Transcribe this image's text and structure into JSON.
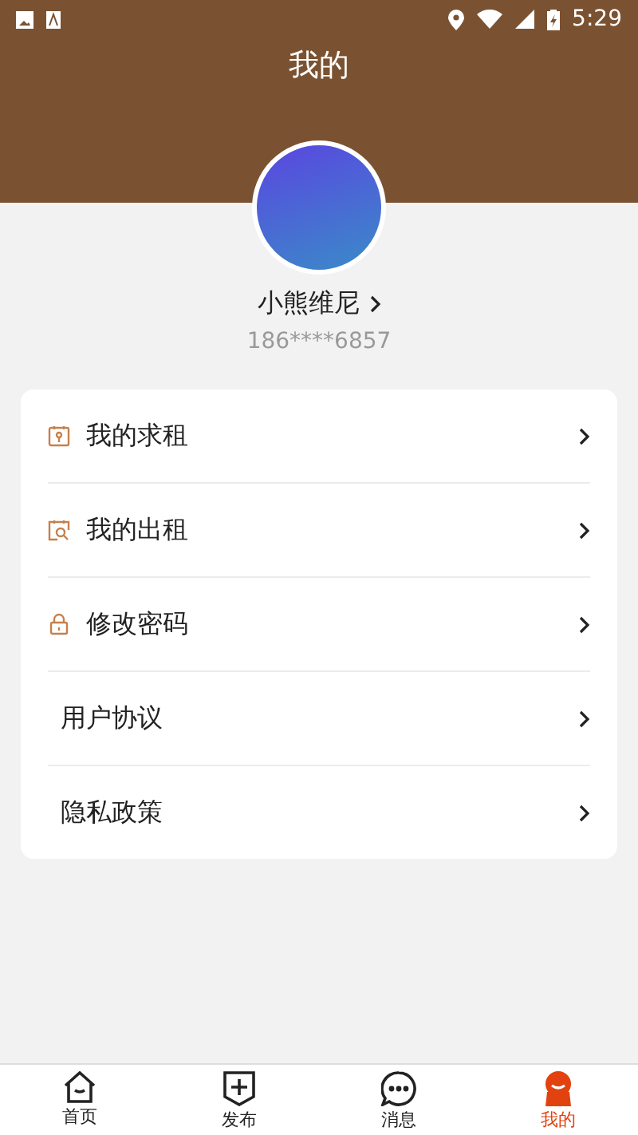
{
  "status_bar": {
    "time": "5:29"
  },
  "header": {
    "title": "我的"
  },
  "profile": {
    "name": "小熊维尼",
    "phone": "186****6857"
  },
  "menu": [
    {
      "label": "我的求租",
      "kind": "calendar-key"
    },
    {
      "label": "我的出租",
      "kind": "calendar-search"
    },
    {
      "label": "修改密码",
      "kind": "lock"
    },
    {
      "label": "用户协议",
      "kind": "plain"
    },
    {
      "label": "隐私政策",
      "kind": "plain"
    }
  ],
  "tabs": [
    {
      "label": "首页",
      "kind": "home",
      "selected": false
    },
    {
      "label": "发布",
      "kind": "publish",
      "selected": false
    },
    {
      "label": "消息",
      "kind": "message",
      "selected": false
    },
    {
      "label": "我的",
      "kind": "me",
      "selected": true
    }
  ]
}
